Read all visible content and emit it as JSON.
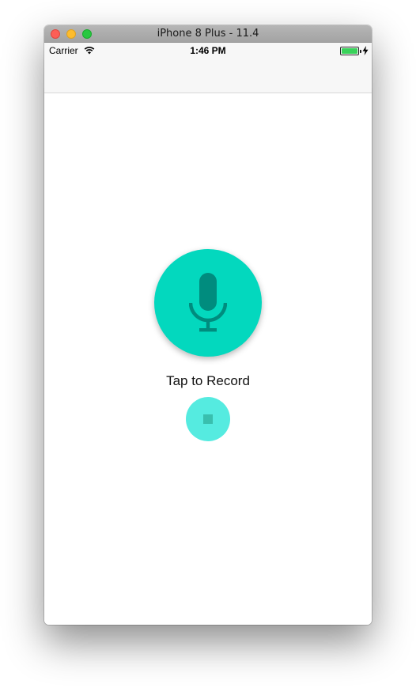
{
  "window": {
    "title": "iPhone 8 Plus - 11.4"
  },
  "status_bar": {
    "carrier": "Carrier",
    "time": "1:46 PM",
    "battery_level": 1.0,
    "charging": true,
    "icons": [
      "wifi-icon",
      "battery-icon",
      "charging-bolt-icon"
    ]
  },
  "recorder": {
    "record_label": "Tap to Record",
    "record_button_icon": "microphone-icon",
    "stop_button_icon": "stop-icon",
    "stop_enabled": false
  },
  "colors": {
    "record_button": "#03d8be",
    "microphone": "#008c7e",
    "stop_button": "#55ebe0",
    "stop_square": "#39bfae",
    "battery": "#39d25a"
  }
}
